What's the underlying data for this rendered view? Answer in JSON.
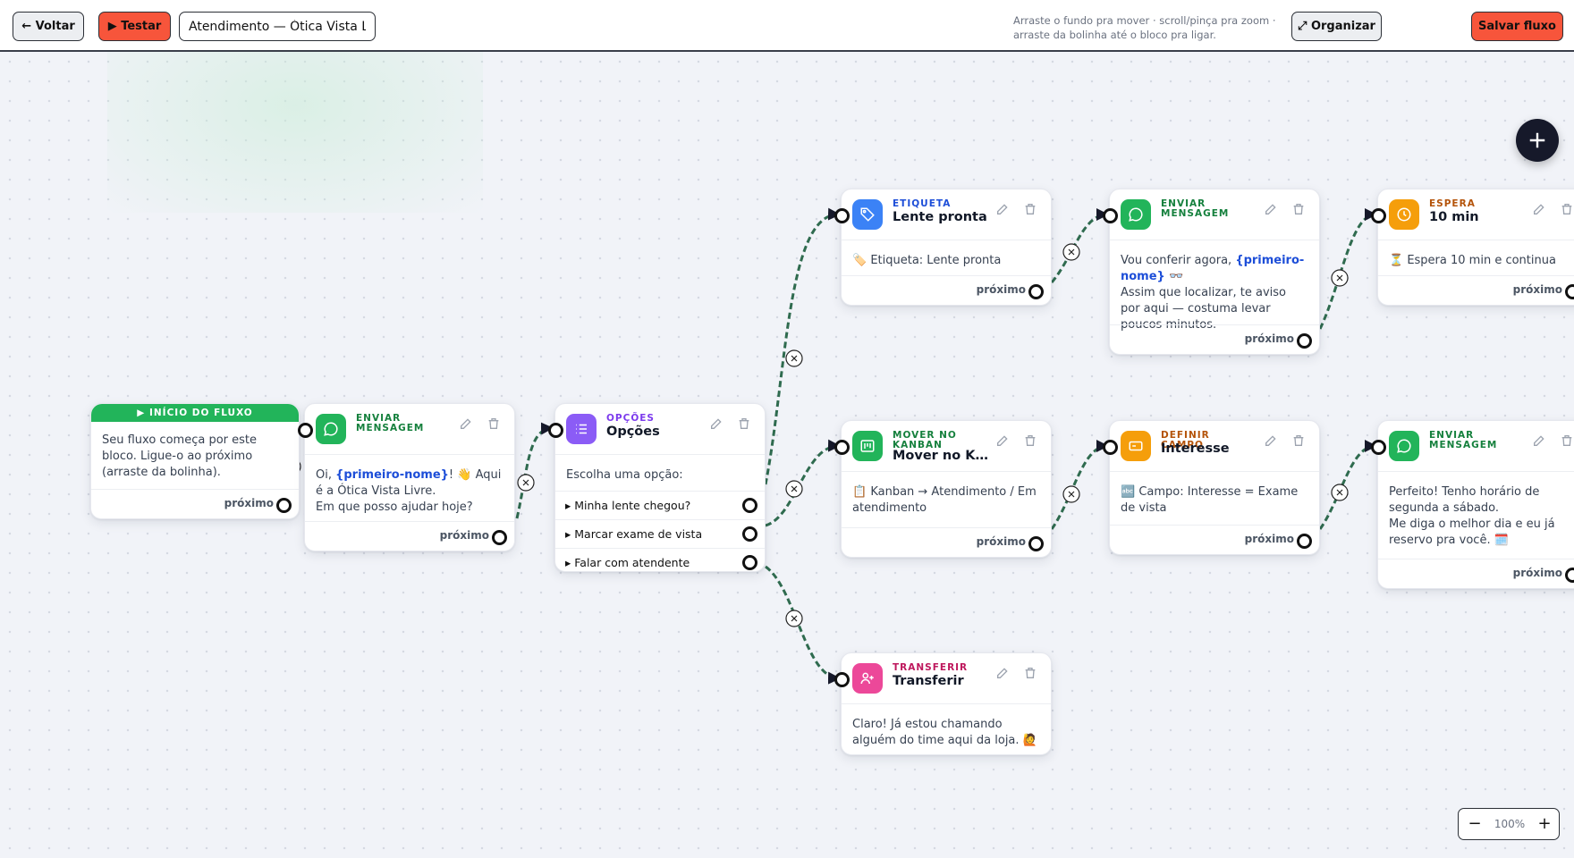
{
  "toolbar": {
    "back_label": "← Voltar",
    "test_label": "▶ Testar",
    "flow_name": "Atendimento — Ótica Vista Liv",
    "hint_line1": "Arraste o fundo pra mover · scroll/pinça pra zoom ·",
    "hint_line2": "arraste da bolinha até o bloco pra ligar.",
    "organize_label": "⤢ Organizar",
    "save_label": "Salvar fluxo"
  },
  "common": {
    "next_label": "próximo"
  },
  "start": {
    "band": "▶ INÍCIO DO FLUXO",
    "text": "Seu fluxo começa por este bloco. Ligue-o ao próximo (arraste da bolinha)."
  },
  "nodes": {
    "msg1": {
      "type": "ENVIAR MENSAGEM",
      "text_pre": "Oi, ",
      "var": "{primeiro-nome}",
      "text_post": "! 👋 Aqui é a Ótica Vista Livre.",
      "text_line2": "Em que posso ajudar hoje?"
    },
    "options": {
      "type": "OPÇÕES",
      "title": "Opções",
      "prompt": "Escolha uma opção:",
      "items": [
        "▸ Minha lente chegou?",
        "▸ Marcar exame de vista",
        "▸ Falar com atendente"
      ]
    },
    "tag": {
      "type": "ETIQUETA",
      "title": "Lente pronta",
      "text": "🏷️ Etiqueta: Lente pronta"
    },
    "msg2": {
      "type": "ENVIAR MENSAGEM",
      "text_pre": "Vou conferir agora, ",
      "var": "{primeiro-nome}",
      "text_post": " 👓",
      "text_line2": "Assim que localizar, te aviso por aqui — costuma levar poucos minutos."
    },
    "wait": {
      "type": "ESPERA",
      "title": "10 min",
      "text": "⏳ Espera 10 min e continua"
    },
    "kanban": {
      "type": "MOVER NO KANBAN",
      "title": "Mover no K…",
      "text": "📋 Kanban → Atendimento / Em atendimento"
    },
    "field": {
      "type": "DEFINIR CAMPO",
      "title": "Interesse",
      "text": "🔤 Campo: Interesse = Exame de vista"
    },
    "msg3": {
      "type": "ENVIAR MENSAGEM",
      "text": "Perfeito! Tenho horário de segunda a sábado.",
      "text_line2": "Me diga o melhor dia e eu já reservo pra você. 🗓️"
    },
    "transfer": {
      "type": "TRANSFERIR",
      "title": "Transferir",
      "text": "Claro! Já estou chamando alguém do time aqui da loja. 🙋"
    }
  },
  "zoom": {
    "minus": "−",
    "value": "100%",
    "plus": "+"
  },
  "colors": {
    "accent_red": "#f7553b",
    "message_green": "#22b45a",
    "options_purple": "#8b5cf6",
    "tag_blue": "#3b82f6",
    "wait_orange": "#f59e0b",
    "transfer_pink": "#ec4899",
    "wire_green": "#2f6b4f"
  },
  "icons": [
    "chat-icon",
    "list-icon",
    "tag-icon",
    "clock-icon",
    "kanban-icon",
    "field-icon",
    "user-plus-icon",
    "pencil-icon",
    "trash-icon",
    "plus-icon"
  ]
}
